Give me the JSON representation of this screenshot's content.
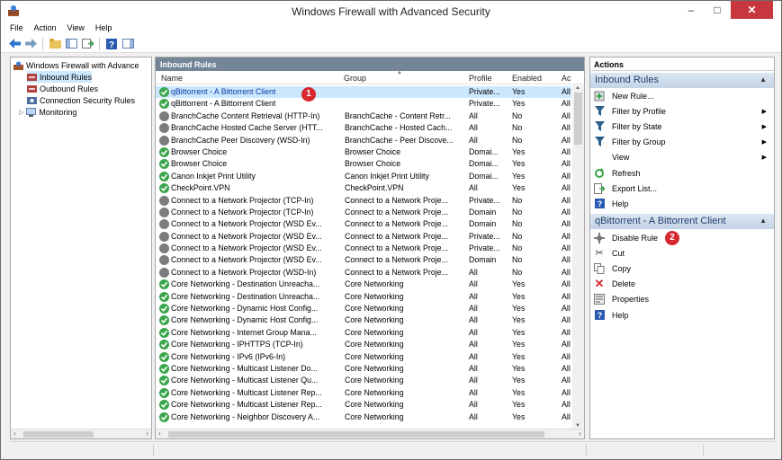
{
  "window": {
    "title": "Windows Firewall with Advanced Security"
  },
  "menu": [
    "File",
    "Action",
    "View",
    "Help"
  ],
  "tree": {
    "items": [
      {
        "label": "Windows Firewall with Advance",
        "icon": "firewall-icon",
        "level": 0
      },
      {
        "label": "Inbound Rules",
        "icon": "inbound-rules-icon",
        "level": 1
      },
      {
        "label": "Outbound Rules",
        "icon": "outbound-rules-icon",
        "level": 1
      },
      {
        "label": "Connection Security Rules",
        "icon": "connection-security-icon",
        "level": 1
      },
      {
        "label": "Monitoring",
        "icon": "monitoring-icon",
        "level": 1
      }
    ]
  },
  "center": {
    "title": "Inbound Rules",
    "columns": [
      "Name",
      "Group",
      "Profile",
      "Enabled",
      "Ac"
    ],
    "rows": [
      {
        "name": "qBittorrent - A Bittorrent Client",
        "group": "",
        "profile": "Private...",
        "enabled": "Yes",
        "action": "All",
        "on": true
      },
      {
        "name": "qBittorrent - A Bittorrent Client",
        "group": "",
        "profile": "Private...",
        "enabled": "Yes",
        "action": "All",
        "on": true
      },
      {
        "name": "BranchCache Content Retrieval (HTTP-In)",
        "group": "BranchCache - Content Retr...",
        "profile": "All",
        "enabled": "No",
        "action": "All",
        "on": false
      },
      {
        "name": "BranchCache Hosted Cache Server (HTT...",
        "group": "BranchCache - Hosted Cach...",
        "profile": "All",
        "enabled": "No",
        "action": "All",
        "on": false
      },
      {
        "name": "BranchCache Peer Discovery (WSD-In)",
        "group": "BranchCache - Peer Discove...",
        "profile": "All",
        "enabled": "No",
        "action": "All",
        "on": false
      },
      {
        "name": "Browser Choice",
        "group": "Browser Choice",
        "profile": "Domai...",
        "enabled": "Yes",
        "action": "All",
        "on": true
      },
      {
        "name": "Browser Choice",
        "group": "Browser Choice",
        "profile": "Domai...",
        "enabled": "Yes",
        "action": "All",
        "on": true
      },
      {
        "name": "Canon Inkjet Print Utility",
        "group": "Canon Inkjet Print Utility",
        "profile": "Domai...",
        "enabled": "Yes",
        "action": "All",
        "on": true
      },
      {
        "name": "CheckPoint.VPN",
        "group": "CheckPoint.VPN",
        "profile": "All",
        "enabled": "Yes",
        "action": "All",
        "on": true
      },
      {
        "name": "Connect to a Network Projector (TCP-In)",
        "group": "Connect to a Network Proje...",
        "profile": "Private...",
        "enabled": "No",
        "action": "All",
        "on": false
      },
      {
        "name": "Connect to a Network Projector (TCP-In)",
        "group": "Connect to a Network Proje...",
        "profile": "Domain",
        "enabled": "No",
        "action": "All",
        "on": false
      },
      {
        "name": "Connect to a Network Projector (WSD Ev...",
        "group": "Connect to a Network Proje...",
        "profile": "Domain",
        "enabled": "No",
        "action": "All",
        "on": false
      },
      {
        "name": "Connect to a Network Projector (WSD Ev...",
        "group": "Connect to a Network Proje...",
        "profile": "Private...",
        "enabled": "No",
        "action": "All",
        "on": false
      },
      {
        "name": "Connect to a Network Projector (WSD Ev...",
        "group": "Connect to a Network Proje...",
        "profile": "Private...",
        "enabled": "No",
        "action": "All",
        "on": false
      },
      {
        "name": "Connect to a Network Projector (WSD Ev...",
        "group": "Connect to a Network Proje...",
        "profile": "Domain",
        "enabled": "No",
        "action": "All",
        "on": false
      },
      {
        "name": "Connect to a Network Projector (WSD-In)",
        "group": "Connect to a Network Proje...",
        "profile": "All",
        "enabled": "No",
        "action": "All",
        "on": false
      },
      {
        "name": "Core Networking - Destination Unreacha...",
        "group": "Core Networking",
        "profile": "All",
        "enabled": "Yes",
        "action": "All",
        "on": true
      },
      {
        "name": "Core Networking - Destination Unreacha...",
        "group": "Core Networking",
        "profile": "All",
        "enabled": "Yes",
        "action": "All",
        "on": true
      },
      {
        "name": "Core Networking - Dynamic Host Config...",
        "group": "Core Networking",
        "profile": "All",
        "enabled": "Yes",
        "action": "All",
        "on": true
      },
      {
        "name": "Core Networking - Dynamic Host Config...",
        "group": "Core Networking",
        "profile": "All",
        "enabled": "Yes",
        "action": "All",
        "on": true
      },
      {
        "name": "Core Networking - Internet Group Mana...",
        "group": "Core Networking",
        "profile": "All",
        "enabled": "Yes",
        "action": "All",
        "on": true
      },
      {
        "name": "Core Networking - IPHTTPS (TCP-In)",
        "group": "Core Networking",
        "profile": "All",
        "enabled": "Yes",
        "action": "All",
        "on": true
      },
      {
        "name": "Core Networking - IPv6 (IPv6-In)",
        "group": "Core Networking",
        "profile": "All",
        "enabled": "Yes",
        "action": "All",
        "on": true
      },
      {
        "name": "Core Networking - Multicast Listener Do...",
        "group": "Core Networking",
        "profile": "All",
        "enabled": "Yes",
        "action": "All",
        "on": true
      },
      {
        "name": "Core Networking - Multicast Listener Qu...",
        "group": "Core Networking",
        "profile": "All",
        "enabled": "Yes",
        "action": "All",
        "on": true
      },
      {
        "name": "Core Networking - Multicast Listener Rep...",
        "group": "Core Networking",
        "profile": "All",
        "enabled": "Yes",
        "action": "All",
        "on": true
      },
      {
        "name": "Core Networking - Multicast Listener Rep...",
        "group": "Core Networking",
        "profile": "All",
        "enabled": "Yes",
        "action": "All",
        "on": true
      },
      {
        "name": "Core Networking - Neighbor Discovery A...",
        "group": "Core Networking",
        "profile": "All",
        "enabled": "Yes",
        "action": "All",
        "on": true
      }
    ]
  },
  "actions": {
    "title": "Actions",
    "section1": {
      "title": "Inbound Rules",
      "items": [
        {
          "label": "New Rule...",
          "icon": "new-rule-icon"
        },
        {
          "label": "Filter by Profile",
          "icon": "filter-icon",
          "submenu": true
        },
        {
          "label": "Filter by State",
          "icon": "filter-icon",
          "submenu": true
        },
        {
          "label": "Filter by Group",
          "icon": "filter-icon",
          "submenu": true
        },
        {
          "label": "View",
          "icon": "",
          "submenu": true
        },
        {
          "label": "Refresh",
          "icon": "refresh-icon"
        },
        {
          "label": "Export List...",
          "icon": "export-icon"
        },
        {
          "label": "Help",
          "icon": "help-icon"
        }
      ]
    },
    "section2": {
      "title": "qBittorrent - A Bittorrent Client",
      "items": [
        {
          "label": "Disable Rule",
          "icon": "disable-rule-icon"
        },
        {
          "label": "Cut",
          "icon": "cut-icon"
        },
        {
          "label": "Copy",
          "icon": "copy-icon"
        },
        {
          "label": "Delete",
          "icon": "delete-icon"
        },
        {
          "label": "Properties",
          "icon": "properties-icon"
        },
        {
          "label": "Help",
          "icon": "help-icon"
        }
      ]
    }
  },
  "badges": [
    "1",
    "2"
  ],
  "colors": {
    "selected_row": "#cce8ff",
    "header_bar": "#748598",
    "section_text": "#1e3e6c",
    "badge": "#d7282f",
    "enabled_green": "#3aa54a"
  }
}
